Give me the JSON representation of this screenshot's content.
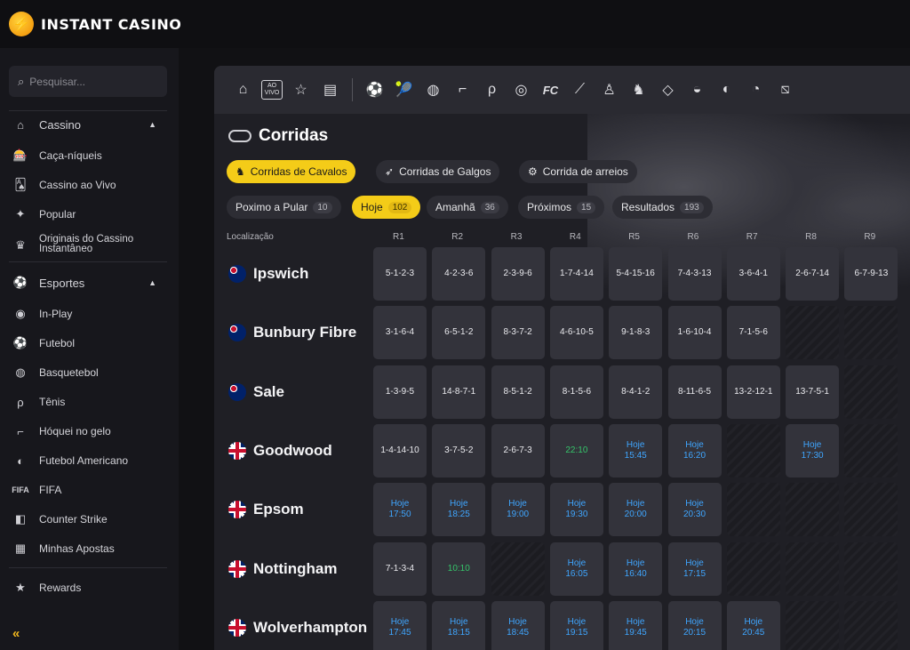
{
  "brand": {
    "name": "INSTANT CASINO",
    "logo_icon": "lightning-bolt-icon",
    "accent": "#f4cc18"
  },
  "sidebar": {
    "search_placeholder": "Pesquisar...",
    "casino_group": {
      "label": "Cassino",
      "icon": "casino-icon"
    },
    "casino_items": [
      {
        "label": "Caça-níqueis",
        "icon": "slots-icon"
      },
      {
        "label": "Cassino ao Vivo",
        "icon": "live-casino-icon"
      },
      {
        "label": "Popular",
        "icon": "sparkle-icon"
      },
      {
        "label": "Originais do Cassino Instantâneo",
        "icon": "originals-icon"
      }
    ],
    "sports_group": {
      "label": "Esportes",
      "icon": "sports-icon"
    },
    "sports_items": [
      {
        "label": "In-Play",
        "icon": "in-play-icon"
      },
      {
        "label": "Futebol",
        "icon": "soccer-icon"
      },
      {
        "label": "Basquetebol",
        "icon": "basketball-icon"
      },
      {
        "label": "Tênis",
        "icon": "tennis-icon"
      },
      {
        "label": "Hóquei no gelo",
        "icon": "ice-hockey-icon"
      },
      {
        "label": "Futebol Americano",
        "icon": "american-football-icon"
      },
      {
        "label": "FIFA",
        "icon": "fifa-icon"
      },
      {
        "label": "Counter Strike",
        "icon": "counter-strike-icon"
      },
      {
        "label": "Minhas Apostas",
        "icon": "my-bets-icon"
      }
    ],
    "rewards": {
      "label": "Rewards",
      "icon": "star-icon"
    },
    "collapse_icon": "double-chevron-left-icon"
  },
  "sports_bar": {
    "live_badge": "AO VIVO",
    "icons": [
      "home-icon",
      "live-icon",
      "star-icon",
      "betslip-icon",
      "soccer-icon",
      "tennis-icon",
      "basketball-icon",
      "ice-hockey-icon",
      "table-tennis-icon",
      "esports-icon",
      "fc-icon",
      "baseball-icon",
      "counter-strike-icon",
      "horse-racing-icon",
      "cricket-icon",
      "volleyball-icon",
      "american-football-icon",
      "esoccer-icon",
      "more-icon"
    ]
  },
  "page": {
    "title": "Corridas",
    "title_icon": "racecourse-icon"
  },
  "race_types": [
    {
      "label": "Corridas de Cavalos",
      "icon": "horse-icon",
      "active": true
    },
    {
      "label": "Corridas de Galgos",
      "icon": "greyhound-icon",
      "active": false
    },
    {
      "label": "Corrida de arreios",
      "icon": "harness-icon",
      "active": false
    }
  ],
  "filters": [
    {
      "label": "Poximo a Pular",
      "count": "10",
      "active": false
    },
    {
      "label": "Hoje",
      "count": "102",
      "active": true
    },
    {
      "label": "Amanhã",
      "count": "36",
      "active": false
    },
    {
      "label": "Próximos",
      "count": "15",
      "active": false
    },
    {
      "label": "Resultados",
      "count": "193",
      "active": false
    }
  ],
  "table": {
    "location_header": "Localização",
    "race_headers": [
      "R1",
      "R2",
      "R3",
      "R4",
      "R5",
      "R6",
      "R7",
      "R8",
      "R9"
    ],
    "rows": [
      {
        "venue": "Ipswich",
        "flag": "au",
        "cells": [
          [
            "5-1-2-3"
          ],
          [
            "4-2-3-6"
          ],
          [
            "2-3-9-6"
          ],
          [
            "1-7-4-14"
          ],
          [
            "5-4-15-16"
          ],
          [
            "7-4-3-13"
          ],
          [
            "3-6-4-1"
          ],
          [
            "2-6-7-14"
          ],
          [
            "6-7-9-13"
          ]
        ]
      },
      {
        "venue": "Bunbury Fibre",
        "flag": "au",
        "cells": [
          [
            "3-1-6-4"
          ],
          [
            "6-5-1-2"
          ],
          [
            "8-3-7-2"
          ],
          [
            "4-6-10-5"
          ],
          [
            "9-1-8-3"
          ],
          [
            "1-6-10-4"
          ],
          [
            "7-1-5-6"
          ],
          null,
          null
        ]
      },
      {
        "venue": "Sale",
        "flag": "au",
        "cells": [
          [
            "1-3-9-5"
          ],
          [
            "14-8-7-1"
          ],
          [
            "8-5-1-2"
          ],
          [
            "8-1-5-6"
          ],
          [
            "8-4-1-2"
          ],
          [
            "8-11-6-5"
          ],
          [
            "13-2-12-1"
          ],
          [
            "13-7-5-1"
          ],
          null
        ]
      },
      {
        "venue": "Goodwood",
        "flag": "gb",
        "cells": [
          [
            "1-4-14-10"
          ],
          [
            "3-7-5-2"
          ],
          [
            "2-6-7-3"
          ],
          [
            "22:10",
            "green"
          ],
          [
            "Hoje",
            "15:45"
          ],
          [
            "Hoje",
            "16:20"
          ],
          null,
          [
            "Hoje",
            "17:30"
          ],
          null
        ]
      },
      {
        "venue": "Epsom",
        "flag": "gb",
        "cells": [
          [
            "Hoje",
            "17:50"
          ],
          [
            "Hoje",
            "18:25"
          ],
          [
            "Hoje",
            "19:00"
          ],
          [
            "Hoje",
            "19:30"
          ],
          [
            "Hoje",
            "20:00"
          ],
          [
            "Hoje",
            "20:30"
          ],
          null,
          null,
          null
        ]
      },
      {
        "venue": "Nottingham",
        "flag": "gb",
        "cells": [
          [
            "7-1-3-4"
          ],
          [
            "10:10",
            "green"
          ],
          null,
          [
            "Hoje",
            "16:05"
          ],
          [
            "Hoje",
            "16:40"
          ],
          [
            "Hoje",
            "17:15"
          ],
          null,
          null,
          null
        ]
      },
      {
        "venue": "Wolverhampton",
        "flag": "gb",
        "cells": [
          [
            "Hoje",
            "17:45"
          ],
          [
            "Hoje",
            "18:15"
          ],
          [
            "Hoje",
            "18:45"
          ],
          [
            "Hoje",
            "19:15"
          ],
          [
            "Hoje",
            "19:45"
          ],
          [
            "Hoje",
            "20:15"
          ],
          [
            "Hoje",
            "20:45"
          ],
          null,
          null
        ]
      }
    ]
  }
}
